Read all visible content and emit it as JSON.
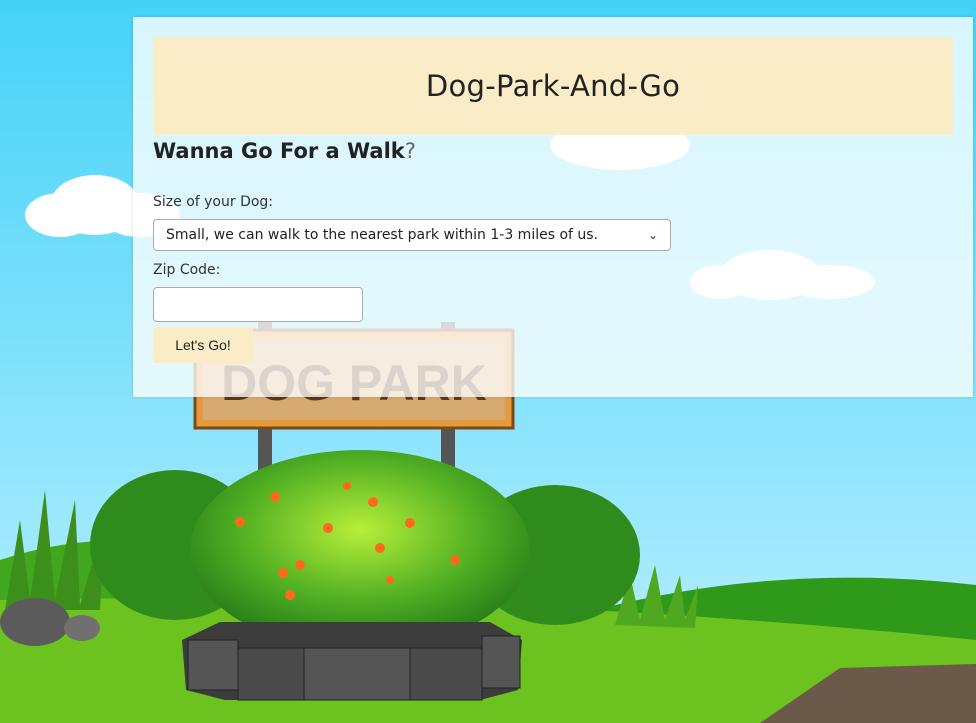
{
  "header": {
    "title": "Dog-Park-And-Go"
  },
  "form": {
    "heading": "Wanna Go For a Walk",
    "heading_mark": "?",
    "size_label": "Size of your Dog:",
    "size_selected": "Small, we can walk to the nearest park within 1-3 miles of us.",
    "zip_label": "Zip Code:",
    "zip_value": "",
    "submit_label": "Let's Go!"
  },
  "scene": {
    "sign_text": "DOG PARK"
  },
  "colors": {
    "sky": "#4fd3f5",
    "banner": "#faecc7",
    "grass": "#6cc21f",
    "path": "#6b5a4a"
  },
  "icons": {
    "select_arrow": "chevron-down-icon"
  }
}
